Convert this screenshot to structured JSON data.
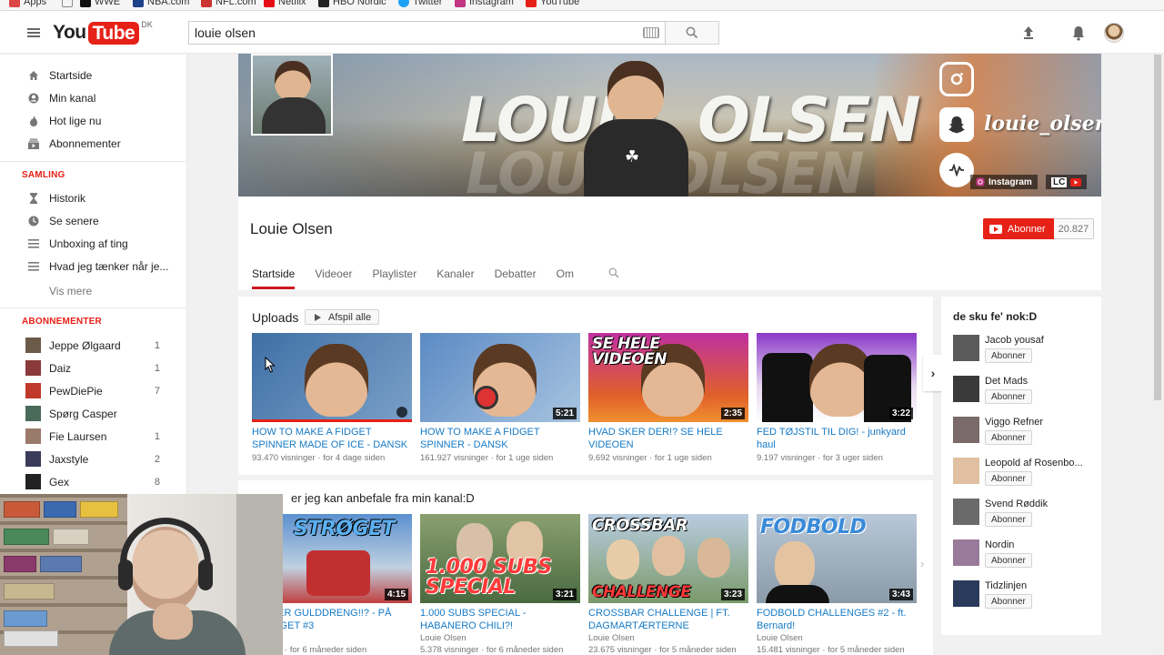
{
  "bookmarks": [
    "Apps",
    "WWE",
    "NBA.com",
    "NFL.com",
    "Netflix",
    "HBO Nordic",
    "Twitter",
    "Instagram",
    "YouTube"
  ],
  "masthead": {
    "logo_you": "You",
    "logo_tube": "Tube",
    "logo_region": "DK",
    "search_value": "louie olsen"
  },
  "sidebar": {
    "main_items": [
      {
        "label": "Startside",
        "icon": "home-icon"
      },
      {
        "label": "Min kanal",
        "icon": "person-icon"
      },
      {
        "label": "Hot lige nu",
        "icon": "flame-icon"
      },
      {
        "label": "Abonnementer",
        "icon": "subscriptions-icon"
      }
    ],
    "samling_heading": "SAMLING",
    "samling_items": [
      {
        "label": "Historik",
        "icon": "hourglass-icon"
      },
      {
        "label": "Se senere",
        "icon": "clock-icon"
      },
      {
        "label": "Unboxing af ting",
        "icon": "playlist-icon"
      },
      {
        "label": "Hvad jeg tænker når je...",
        "icon": "playlist-icon"
      }
    ],
    "more_label": "Vis mere",
    "subs_heading": "ABONNEMENTER",
    "subscriptions": [
      {
        "label": "Jeppe Ølgaard",
        "count": "1",
        "color": "#6b5a4a"
      },
      {
        "label": "Daiz",
        "count": "1",
        "color": "#8a3a3a"
      },
      {
        "label": "PewDiePie",
        "count": "7",
        "color": "#c0392b"
      },
      {
        "label": "Spørg Casper",
        "count": "",
        "color": "#4a6a5a"
      },
      {
        "label": "Fie Laursen",
        "count": "1",
        "color": "#9a7a6a"
      },
      {
        "label": "Jaxstyle",
        "count": "2",
        "color": "#3a3a5a"
      },
      {
        "label": "Gex",
        "count": "8",
        "color": "#222222"
      }
    ]
  },
  "banner": {
    "text_left": "LOUIE",
    "text_right": "OLSEN",
    "handle": "louie_olsen",
    "instagram_link": "Instagram",
    "lc_link": "LC"
  },
  "channel": {
    "name": "Louie Olsen",
    "subscribe_label": "Abonner",
    "subscriber_count": "20.827",
    "tabs": [
      "Startside",
      "Videoer",
      "Playlister",
      "Kanaler",
      "Debatter",
      "Om"
    ]
  },
  "uploads": {
    "title": "Uploads",
    "play_all": "Afspil alle",
    "videos": [
      {
        "title": "HOW TO MAKE A FIDGET SPINNER MADE OF ICE - DANSK",
        "views": "93.470 visninger",
        "age": "for 4 dage siden",
        "duration": "",
        "bg": "#4a7ab0",
        "overlay": ""
      },
      {
        "title": "HOW TO MAKE A FIDGET SPINNER - DANSK",
        "views": "161.927 visninger",
        "age": "for 1 uge siden",
        "duration": "5:21",
        "bg": "#6a9ad0",
        "overlay": ""
      },
      {
        "title": "HVAD SKER DER!? SE HELE VIDEOEN",
        "views": "9.692 visninger",
        "age": "for 1 uge siden",
        "duration": "2:35",
        "bg": "#d04a8a",
        "overlay": "SE HELE VIDEOEN"
      },
      {
        "title": "FED TØJSTIL TIL DIG! - junkyard haul",
        "views": "9.197 visninger",
        "age": "for 3 uger siden",
        "duration": "3:22",
        "bg": "#b070c0",
        "overlay": ""
      }
    ]
  },
  "recommended": {
    "title_visible": "er jeg kan anbefale fra min kanal:D",
    "videos": [
      {
        "title": "VIEWER GULDDRENG!!? - PÅ STRØGET #3",
        "channel": "sen",
        "views": "isninger",
        "age": "for 6 måneder siden",
        "duration": "4:15",
        "bg": "#4a8ad0",
        "overlay": "STRØGET"
      },
      {
        "title": "1.000 SUBS SPECIAL - HABANERO CHILI?!",
        "channel": "Louie Olsen",
        "views": "5.378 visninger",
        "age": "for 6 måneder siden",
        "duration": "3:21",
        "bg": "#6a8a5a",
        "overlay": "1.000 SUBS SPECIAL"
      },
      {
        "title": "CROSSBAR CHALLENGE | FT. DAGMARTÆRTERNE",
        "channel": "Louie Olsen",
        "views": "23.675 visninger",
        "age": "for 5 måneder siden",
        "duration": "3:23",
        "bg": "#8aa8c0",
        "overlay": "CROSSBAR CHALLENGE"
      },
      {
        "title": "FODBOLD CHALLENGES #2 - ft. Bernard!",
        "channel": "Louie Olsen",
        "views": "15.481 visninger",
        "age": "for 5 måneder siden",
        "duration": "3:43",
        "bg": "#9ab0c8",
        "overlay": "FODBOLD"
      }
    ]
  },
  "related": {
    "title": "de sku fe' nok:D",
    "subscribe_label": "Abonner",
    "channels": [
      {
        "name": "Jacob yousaf",
        "color": "#5a5a5a"
      },
      {
        "name": "Det Mads",
        "color": "#3a3a3a"
      },
      {
        "name": "Viggo Refner",
        "color": "#7a6a6a"
      },
      {
        "name": "Leopold af Rosenbo...",
        "color": "#e0c0a0"
      },
      {
        "name": "Svend Røddik",
        "color": "#6a6a6a"
      },
      {
        "name": "Nordin",
        "color": "#9a7a9a"
      },
      {
        "name": "Tidzlinjen",
        "color": "#2a3a5a"
      }
    ]
  }
}
